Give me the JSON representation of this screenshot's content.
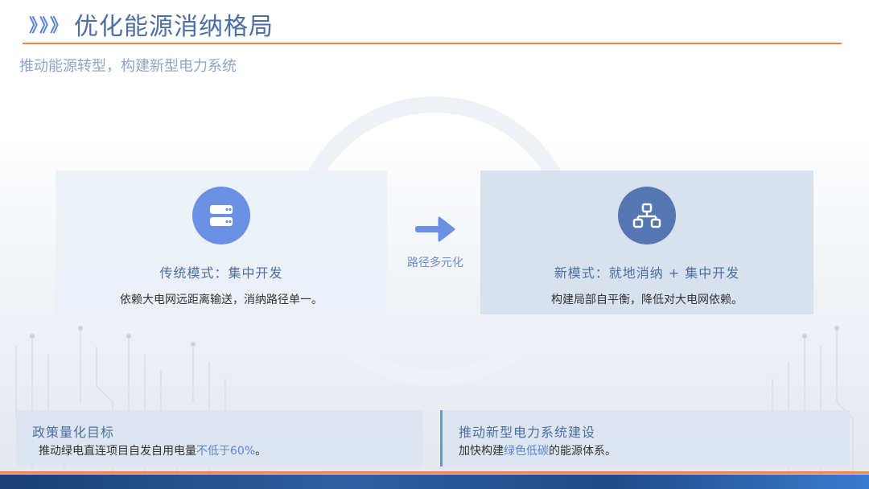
{
  "header": {
    "chevrons": "》》》",
    "title": "优化能源消纳格局",
    "subtitle": "推动能源转型，构建新型电力系统"
  },
  "cards": {
    "left": {
      "icon": "server-icon",
      "title": "传统模式：集中开发",
      "desc": "依赖大电网远距离输送，消纳路径单一。"
    },
    "right": {
      "icon": "network-icon",
      "title": "新模式：就地消纳 + 集中开发",
      "desc": "构建局部自平衡，降低对大电网依赖。"
    }
  },
  "transition": {
    "icon": "arrow-right-icon",
    "label": "路径多元化"
  },
  "bottom": {
    "left": {
      "title": "政策量化目标",
      "desc_prefix": "推动绿电直连项目自发自用电量",
      "desc_highlight": "不低于60%",
      "desc_suffix": "。"
    },
    "right": {
      "title": "推动新型电力系统建设",
      "desc_prefix": "加快构建",
      "desc_highlight": "绿色低碳",
      "desc_suffix": "的能源体系。"
    }
  },
  "colors": {
    "accent_blue": "#5b85d6",
    "title_blue": "#4d6fa3",
    "orange_line": "#e8884a"
  }
}
